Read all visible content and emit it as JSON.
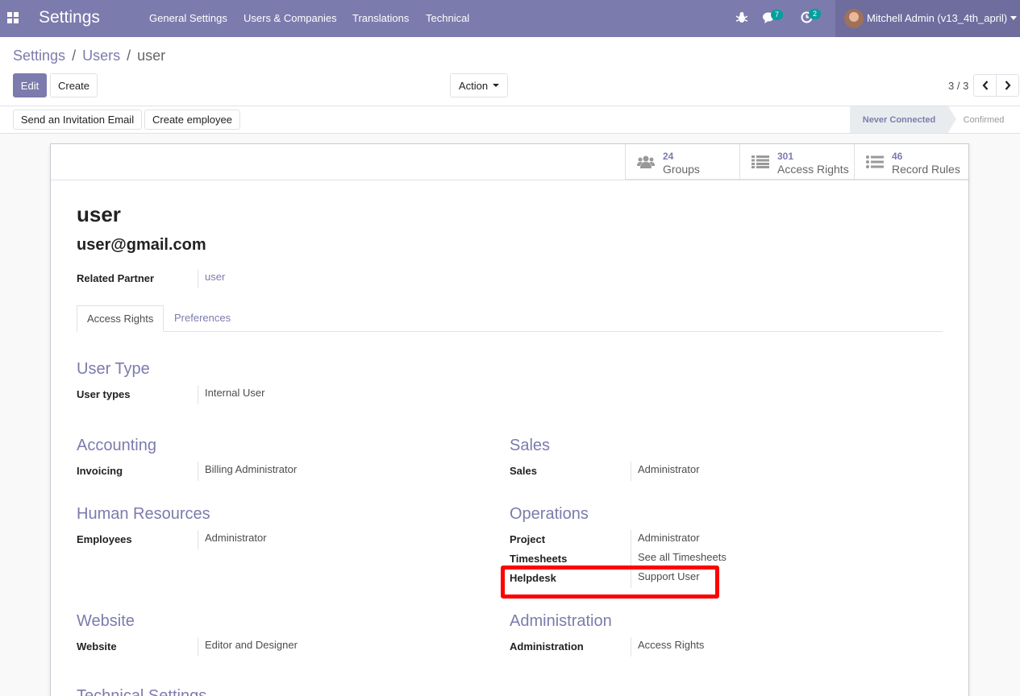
{
  "navbar": {
    "brand": "Settings",
    "menu": [
      "General Settings",
      "Users & Companies",
      "Translations",
      "Technical"
    ],
    "messages_count": "7",
    "activities_count": "2",
    "user_name": "Mitchell Admin (v13_4th_april)"
  },
  "breadcrumb": {
    "items": [
      "Settings",
      "Users"
    ],
    "current": "user",
    "separator": "/"
  },
  "controls": {
    "edit_label": "Edit",
    "create_label": "Create",
    "action_label": "Action",
    "pager": "3 / 3"
  },
  "header_buttons": {
    "invite_label": "Send an Invitation Email",
    "create_employee_label": "Create employee"
  },
  "status": {
    "current": "Never Connected",
    "next": "Confirmed"
  },
  "stats": [
    {
      "count": "24",
      "label": "Groups",
      "icon": "users-icon"
    },
    {
      "count": "301",
      "label": "Access Rights",
      "icon": "list-icon"
    },
    {
      "count": "46",
      "label": "Record Rules",
      "icon": "list-ul-icon"
    }
  ],
  "record": {
    "name": "user",
    "email": "user@gmail.com",
    "related_partner_label": "Related Partner",
    "related_partner_value": "user"
  },
  "tabs": [
    "Access Rights",
    "Preferences"
  ],
  "sections": {
    "user_type": {
      "title": "User Type",
      "label": "User types",
      "value": "Internal User"
    },
    "accounting": {
      "title": "Accounting",
      "label": "Invoicing",
      "value": "Billing Administrator"
    },
    "sales": {
      "title": "Sales",
      "label": "Sales",
      "value": "Administrator"
    },
    "hr": {
      "title": "Human Resources",
      "label": "Employees",
      "value": "Administrator"
    },
    "operations": {
      "title": "Operations",
      "project_label": "Project",
      "project_value": "Administrator",
      "timesheets_label": "Timesheets",
      "timesheets_value": "See all Timesheets",
      "helpdesk_label": "Helpdesk",
      "helpdesk_value": "Support User"
    },
    "website": {
      "title": "Website",
      "label": "Website",
      "value": "Editor and Designer"
    },
    "administration": {
      "title": "Administration",
      "label": "Administration",
      "value": "Access Rights"
    },
    "technical": {
      "title": "Technical Settings"
    }
  },
  "colors": {
    "brand": "#7c7bad",
    "highlight": "#ff0000",
    "badge": "#00a09d"
  }
}
